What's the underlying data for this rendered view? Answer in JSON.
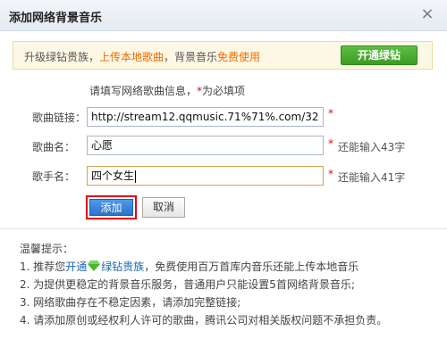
{
  "dialog": {
    "title": "添加网络背景音乐",
    "close_symbol": "×"
  },
  "vip_bar": {
    "prefix": "升级绿钻贵族，",
    "upload_link": "上传本地歌曲",
    "middle": "，背景音乐",
    "free_text": "免费使用",
    "button_label": "开通绿钻",
    "accent_color": "#f46a00",
    "button_color": "#47a82e"
  },
  "form": {
    "hint_prefix": "请填写网络歌曲信息，",
    "hint_star": "*",
    "hint_suffix": "为必填项",
    "required_mark": "*",
    "song_link": {
      "label": "歌曲链接：",
      "value": "http://stream12.qqmusic.71%71%.com/32"
    },
    "song_name": {
      "label": "歌曲名：",
      "value": "心愿",
      "remaining": "还能输入43字"
    },
    "singer_name": {
      "label": "歌手名：",
      "value": "四个女生",
      "remaining": "还能输入41字"
    },
    "add_button": "添加",
    "cancel_button": "取消"
  },
  "tips": {
    "title": "温馨提示：",
    "tip1_prefix": "1. 推荐您",
    "tip1_link1": "开通",
    "tip1_link2": "绿钻贵族",
    "tip1_suffix": "，免费使用百万首库内音乐还能上传本地音乐",
    "tip2": "2. 为提供更稳定的背景音乐服务，普通用户只能设置5首网络背景音乐;",
    "tip3": "3. 网络歌曲存在不稳定因素，请添加完整链接;",
    "tip4": "4. 请添加原创或经权利人许可的歌曲，腾讯公司对相关版权问题不承担负责。",
    "icon": "green-diamond-icon"
  }
}
